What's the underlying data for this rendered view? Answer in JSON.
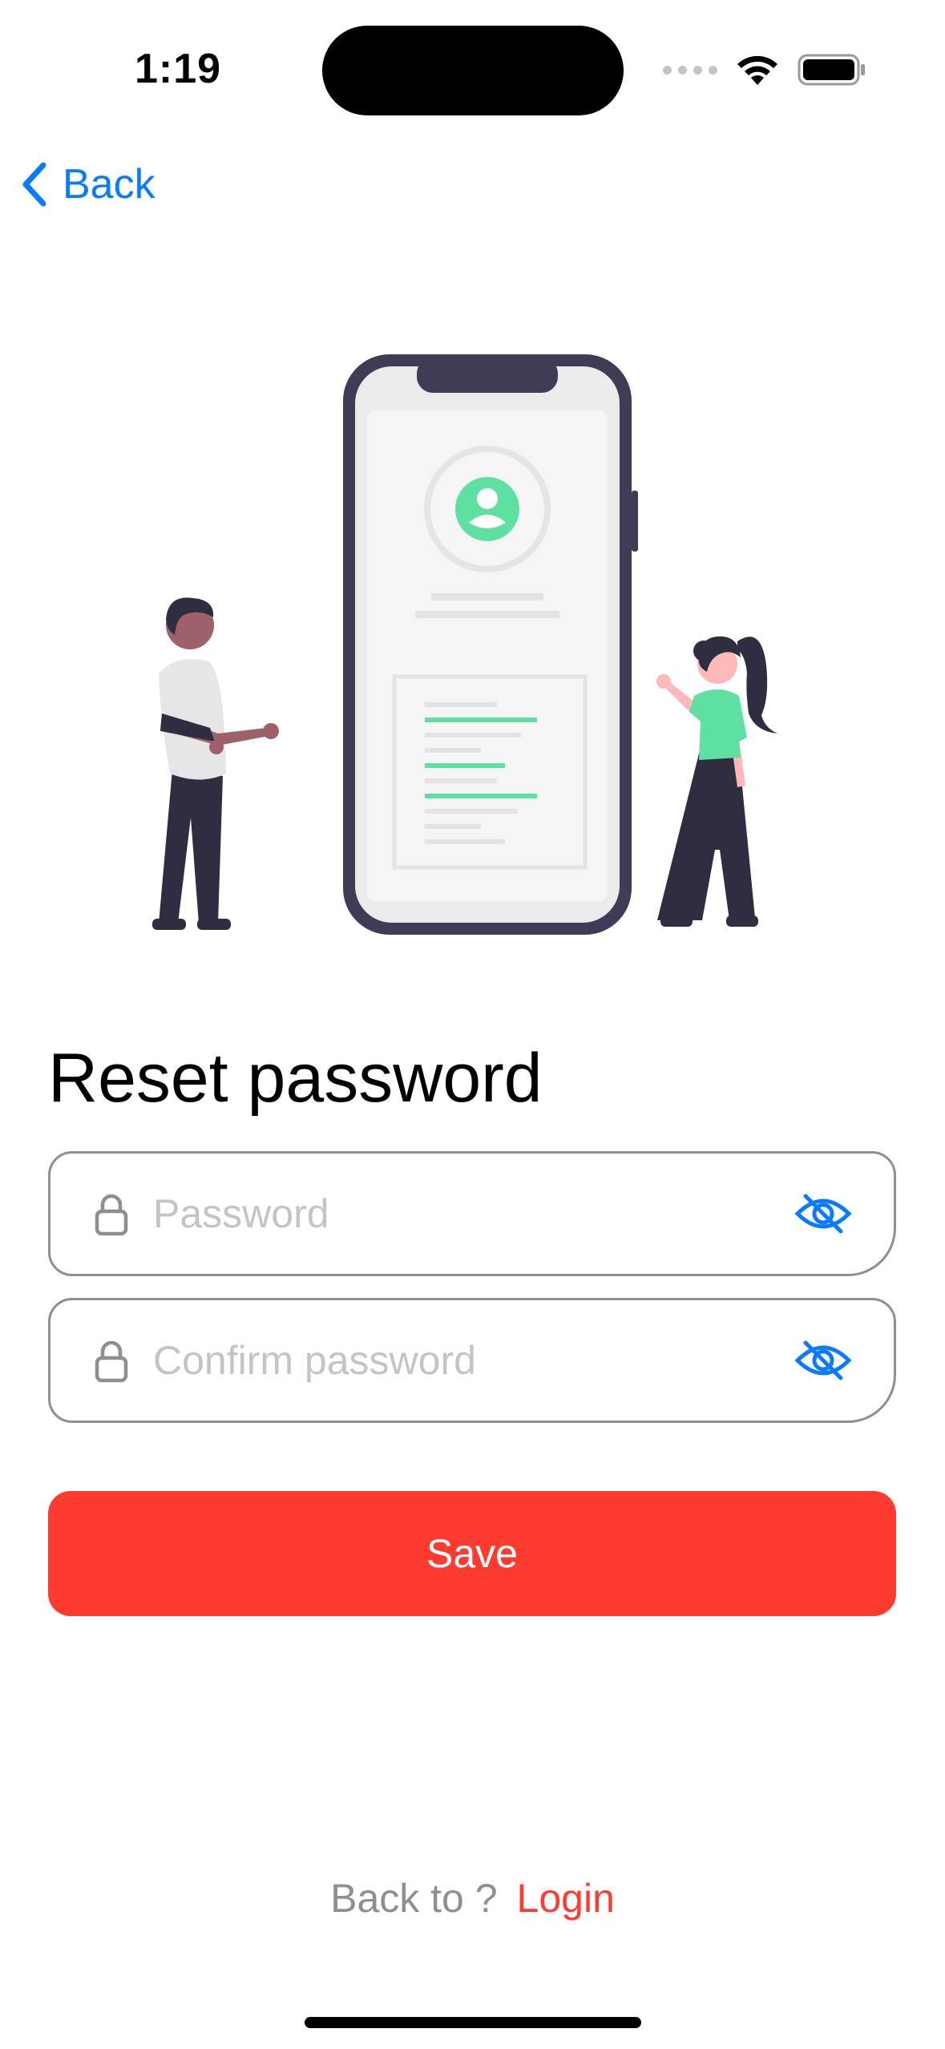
{
  "status_bar": {
    "time": "1:19"
  },
  "nav": {
    "back_label": "Back"
  },
  "form": {
    "title": "Reset password",
    "password_placeholder": "Password",
    "password_value": "",
    "confirm_placeholder": "Confirm password",
    "confirm_value": "",
    "save_label": "Save"
  },
  "footer": {
    "prompt": "Back to ?",
    "link": "Login"
  },
  "icons": {
    "back": "chevron-left-icon",
    "lock": "lock-icon",
    "eye": "eye-slash-icon",
    "wifi": "wifi-icon",
    "battery": "battery-icon",
    "signal": "signal-icon"
  },
  "colors": {
    "accent_blue": "#0a7aff",
    "primary_red": "#ff3b30",
    "illustration_green": "#5fe0a3",
    "illustration_dark": "#3f3d56",
    "placeholder_gray": "#c4c4c8"
  }
}
